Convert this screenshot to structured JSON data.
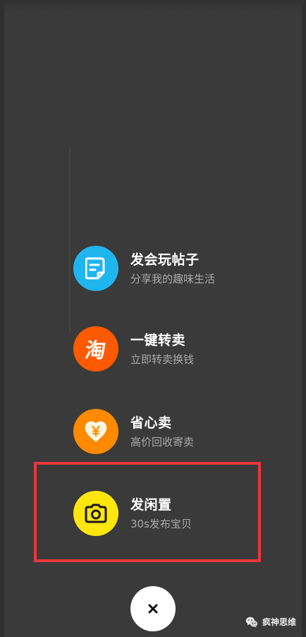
{
  "colors": {
    "overlay_background": "#3a3a3a",
    "highlight_border": "#e8373b",
    "post_icon_bg": "#1fb6ef",
    "resell_icon_bg": "#ff5a00",
    "save_sell_icon_bg": "#ff8a00",
    "idle_icon_bg": "#ffe60d"
  },
  "menu": {
    "items": [
      {
        "title": "发会玩帖子",
        "subtitle": "分享我的趣味生活",
        "icon": "post-note-icon"
      },
      {
        "title": "一键转卖",
        "subtitle": "立即转卖换钱",
        "icon": "taobao-icon",
        "icon_text": "淘"
      },
      {
        "title": "省心卖",
        "subtitle": "高价回收寄卖",
        "icon": "yuan-heart-icon"
      },
      {
        "title": "发闲置",
        "subtitle": "30s发布宝贝",
        "icon": "camera-icon"
      }
    ]
  },
  "close": {
    "icon": "close-icon"
  },
  "watermark": {
    "text": "疯神思维",
    "icon": "wechat-logo-icon"
  }
}
